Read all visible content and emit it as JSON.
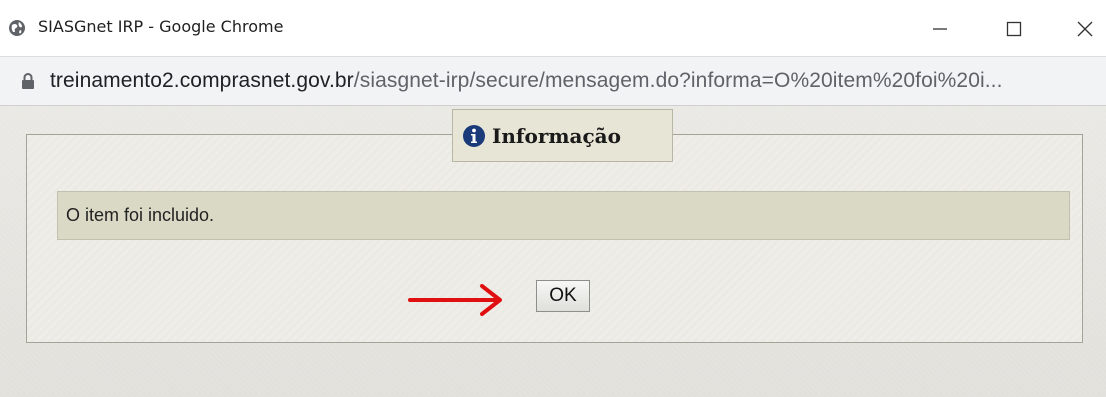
{
  "window": {
    "title": "SIASGnet IRP - Google Chrome",
    "controls": {
      "minimize_icon": "minimize-icon",
      "maximize_icon": "maximize-icon",
      "close_icon": "close-icon"
    }
  },
  "address_bar": {
    "lock_icon": "lock-icon",
    "url_host": "treinamento2.comprasnet.gov.br",
    "url_path": "/siasgnet-irp/secure/mensagem.do?informa=O%20item%20foi%20i..."
  },
  "dialog": {
    "legend_icon": "info-icon",
    "legend_title": "Informação",
    "message": "O item foi incluido.",
    "ok_label": "OK",
    "annotation_icon": "red-arrow-icon"
  },
  "colors": {
    "message_bg": "#dad9c6",
    "legend_bg": "#e7e5d5",
    "arrow": "#e01010",
    "info_icon": "#1a3a7a"
  }
}
